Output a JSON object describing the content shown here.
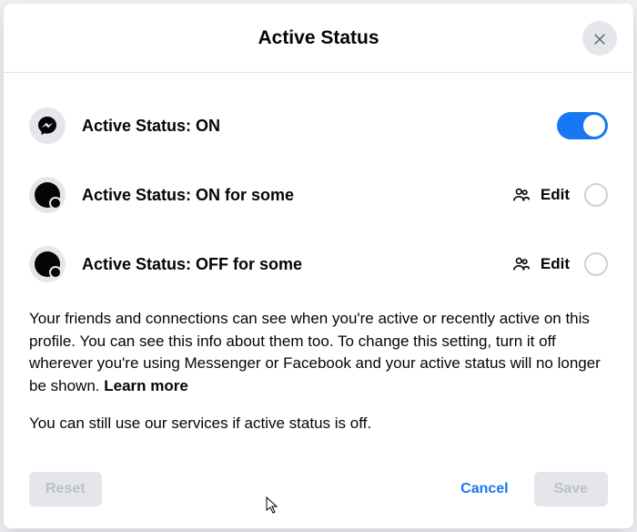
{
  "header": {
    "title": "Active Status"
  },
  "rows": {
    "main": {
      "label": "Active Status: ON"
    },
    "onSome": {
      "label": "Active Status: ON for some",
      "edit": "Edit"
    },
    "offSome": {
      "label": "Active Status: OFF for some",
      "edit": "Edit"
    }
  },
  "description": {
    "text": "Your friends and connections can see when you're active or recently active on this profile. You can see this info about them too. To change this setting, turn it off wherever you're using Messenger or Facebook and your active status will no longer be shown. ",
    "learnMore": "Learn more",
    "secondary": "You can still use our services if active status is off."
  },
  "footer": {
    "reset": "Reset",
    "cancel": "Cancel",
    "save": "Save"
  }
}
